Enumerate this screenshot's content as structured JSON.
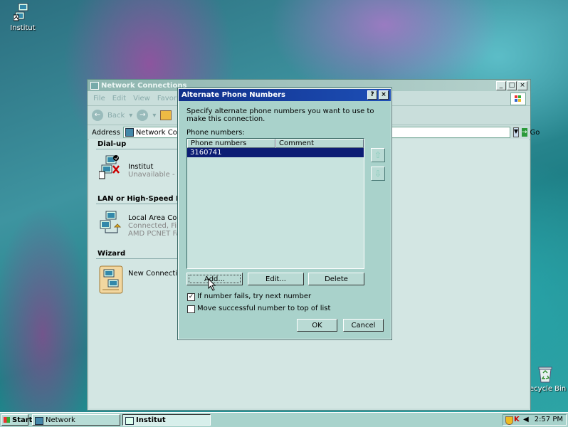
{
  "desktop": {
    "icons": [
      {
        "label": "Institut"
      },
      {
        "label": "ecycle Bin"
      }
    ]
  },
  "window": {
    "title": "Network Connections",
    "menu": [
      "File",
      "Edit",
      "View",
      "Favorites"
    ],
    "toolbar": {
      "back": "Back"
    },
    "address": {
      "label": "Address",
      "value": "Network Connectio",
      "go": "Go"
    },
    "groups": [
      {
        "header": "Dial-up",
        "items": [
          {
            "name": "Institut",
            "sub": [
              "Unavailable - devic"
            ]
          }
        ]
      },
      {
        "header": "LAN or High-Speed Intern",
        "items": [
          {
            "name": "Local Area Connec",
            "sub": [
              "Connected, Firewal",
              "AMD PCNET Famil"
            ]
          }
        ]
      },
      {
        "header": "Wizard",
        "items": [
          {
            "name": "New Connection W",
            "sub": []
          }
        ]
      }
    ]
  },
  "dialog": {
    "title": "Alternate Phone Numbers",
    "help": "?",
    "close": "×",
    "instruction": "Specify alternate phone numbers you want to use to make this connection.",
    "list_label": "Phone numbers:",
    "columns": [
      "Phone numbers",
      "Comment"
    ],
    "rows": [
      {
        "phone": "3160741",
        "comment": ""
      }
    ],
    "buttons": {
      "add": "Add...",
      "edit": "Edit...",
      "delete": "Delete",
      "ok": "OK",
      "cancel": "Cancel"
    },
    "checkboxes": [
      {
        "label": "If number fails, try next number",
        "checked": true
      },
      {
        "label": "Move successful number to top of list",
        "checked": false
      }
    ]
  },
  "taskbar": {
    "start": "Start",
    "tasks": [
      "Network Connections",
      "Institut Properties"
    ],
    "clock": "2:57 PM"
  },
  "colors": {
    "selection": "#0c1d74",
    "dialog_title": "#102f8a"
  }
}
